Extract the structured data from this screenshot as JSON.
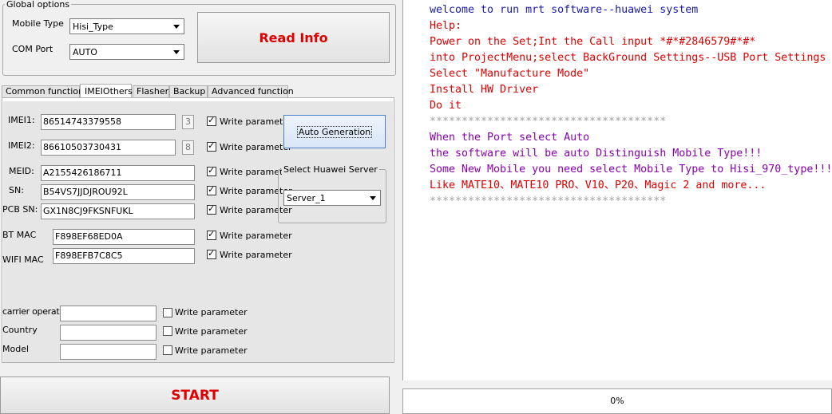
{
  "global_options": {
    "title": "Global options",
    "mobile_type_label": "Mobile Type",
    "mobile_type_value": "Hisi_Type",
    "com_port_label": "COM Port",
    "com_port_value": "AUTO",
    "read_info_label": "Read Info"
  },
  "tabs": [
    "Common functions",
    "IMEIOthers",
    "Flasher",
    "Backup",
    "Advanced function"
  ],
  "imei": {
    "imei1_label": "IMEI1:",
    "imei1_value": "86514743379558",
    "imei1_digit": "3",
    "imei2_label": "IMEI2:",
    "imei2_value": "86610503730431",
    "imei2_digit": "8",
    "meid_label": "MEID:",
    "meid_value": "A2155426186711",
    "sn_label": "SN:",
    "sn_value": "B54VS7JJDJROU92L",
    "pcb_label": "PCB SN:",
    "pcb_value": "GX1N8CJ9FKSNFUKL",
    "bt_label": "BT MAC",
    "bt_value": "F898EF68ED0A",
    "wifi_label": "WIFI MAC",
    "wifi_value": "F898EFB7C8C5",
    "carrier_label": "carrier operator",
    "country_label": "Country",
    "model_label": "Model",
    "write_param": "Write parameter",
    "auto_gen_label": "Auto Generation",
    "server_group_title": "Select Huawei Server",
    "server_value": "Server_1"
  },
  "start_label": "START",
  "log": {
    "lines": [
      {
        "text": "welcome to run mrt software--huawei system",
        "color": "#1a1ab0"
      },
      {
        "text": "Help:",
        "color": "#e00000"
      },
      {
        "text": "Power on the Set;Int the Call input *#*#2846579#*#*",
        "color": "#e00000"
      },
      {
        "text": "into ProjectMenu;select BackGround Settings--USB Port Settings",
        "color": "#e00000"
      },
      {
        "text": "Select \"Manufacture Mode\"",
        "color": "#e00000"
      },
      {
        "text": "Install HW Driver",
        "color": "#e00000"
      },
      {
        "text": "Do it",
        "color": "#e00000"
      },
      {
        "text": "*************************************",
        "color": "#a0a0a0"
      },
      {
        "text": "When the Port select Auto",
        "color": "#8b00b0"
      },
      {
        "text": "the software will be auto Distinguish Mobile Type!!!",
        "color": "#8b00b0"
      },
      {
        "text": "Some New Mobile you need select Mobile Type to Hisi_970_type!!!",
        "color": "#8b00b0"
      },
      {
        "text": "Like MATE10、MATE10 PRO、V10、P20、Magic 2 and more...",
        "color": "#e00000"
      },
      {
        "text": "*************************************",
        "color": "#a0a0a0"
      }
    ]
  },
  "progress_text": "0%"
}
